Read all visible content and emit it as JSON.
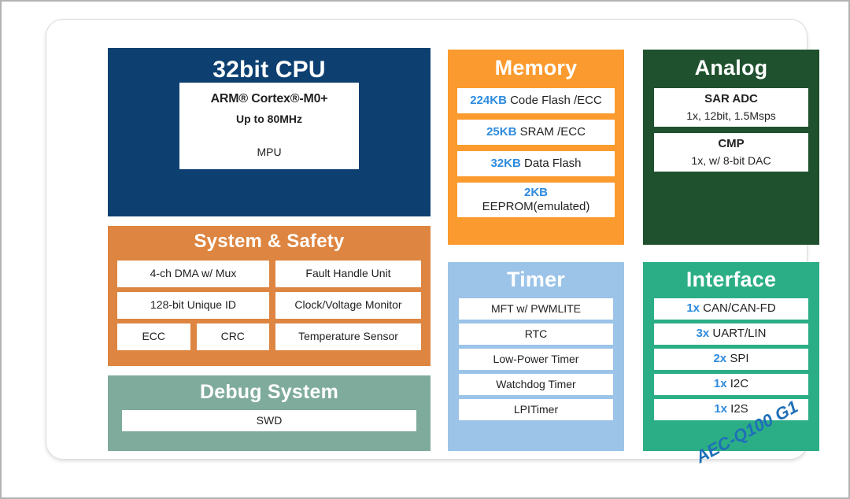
{
  "diagram": {
    "badge": "AEC-Q100 G1",
    "colors": {
      "cpu": "#0d4071",
      "memory": "#fb9a2e",
      "analog": "#20512e",
      "system_safety": "#dd8541",
      "timer": "#9cc3e8",
      "interface": "#2bae85",
      "debug": "#7fab9c",
      "accent_number": "#2e8bde",
      "cell_background": "#ffffff"
    },
    "cpu": {
      "title": "32bit CPU",
      "core_line1": "ARM® Cortex®-M0+",
      "core_line2": "Up to 80MHz",
      "mpu": "MPU"
    },
    "system_safety": {
      "title": "System & Safety",
      "left": [
        "4-ch DMA w/ Mux",
        "128-bit Unique ID"
      ],
      "left_split": [
        "ECC",
        "CRC"
      ],
      "right": [
        "Fault Handle Unit",
        "Clock/Voltage Monitor",
        "Temperature Sensor"
      ]
    },
    "debug": {
      "title": "Debug System",
      "items": [
        "SWD"
      ]
    },
    "memory": {
      "title": "Memory",
      "items": [
        {
          "num": "224KB",
          "text": " Code Flash /ECC"
        },
        {
          "num": "25KB",
          "text": " SRAM /ECC"
        },
        {
          "num": "32KB",
          "text": " Data Flash"
        },
        {
          "num": "2KB",
          "text": "EEPROM(emulated)"
        }
      ]
    },
    "analog": {
      "title": "Analog",
      "items": [
        {
          "name": "SAR ADC",
          "spec": "1x, 12bit, 1.5Msps"
        },
        {
          "name": "CMP",
          "spec": "1x, w/ 8-bit DAC"
        }
      ]
    },
    "timer": {
      "title": "Timer",
      "items": [
        "MFT w/ PWMLITE",
        "RTC",
        "Low-Power Timer",
        "Watchdog Timer",
        "LPITimer"
      ]
    },
    "interface": {
      "title": "Interface",
      "items": [
        {
          "num": "1x",
          "text": " CAN/CAN-FD"
        },
        {
          "num": "3x",
          "text": " UART/LIN"
        },
        {
          "num": "2x",
          "text": " SPI"
        },
        {
          "num": "1x",
          "text": " I2C"
        },
        {
          "num": "1x",
          "text": " I2S"
        }
      ]
    }
  }
}
